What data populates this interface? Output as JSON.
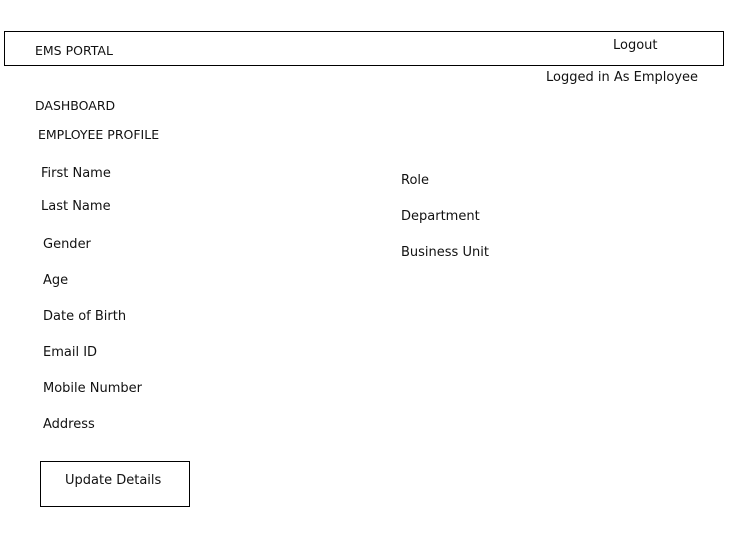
{
  "header": {
    "app_title": "EMS PORTAL",
    "logout_label": "Logout"
  },
  "status": {
    "logged_in_text": "Logged in As Employee"
  },
  "nav": {
    "dashboard_label": "DASHBOARD"
  },
  "profile": {
    "section_title": "EMPLOYEE PROFILE",
    "left_fields": [
      "First Name",
      "Last Name",
      "Gender",
      "Age",
      "Date of Birth",
      "Email ID",
      "Mobile Number",
      "Address"
    ],
    "right_fields": [
      "Role",
      "Department",
      "Business Unit"
    ],
    "update_button_label": "Update Details"
  }
}
